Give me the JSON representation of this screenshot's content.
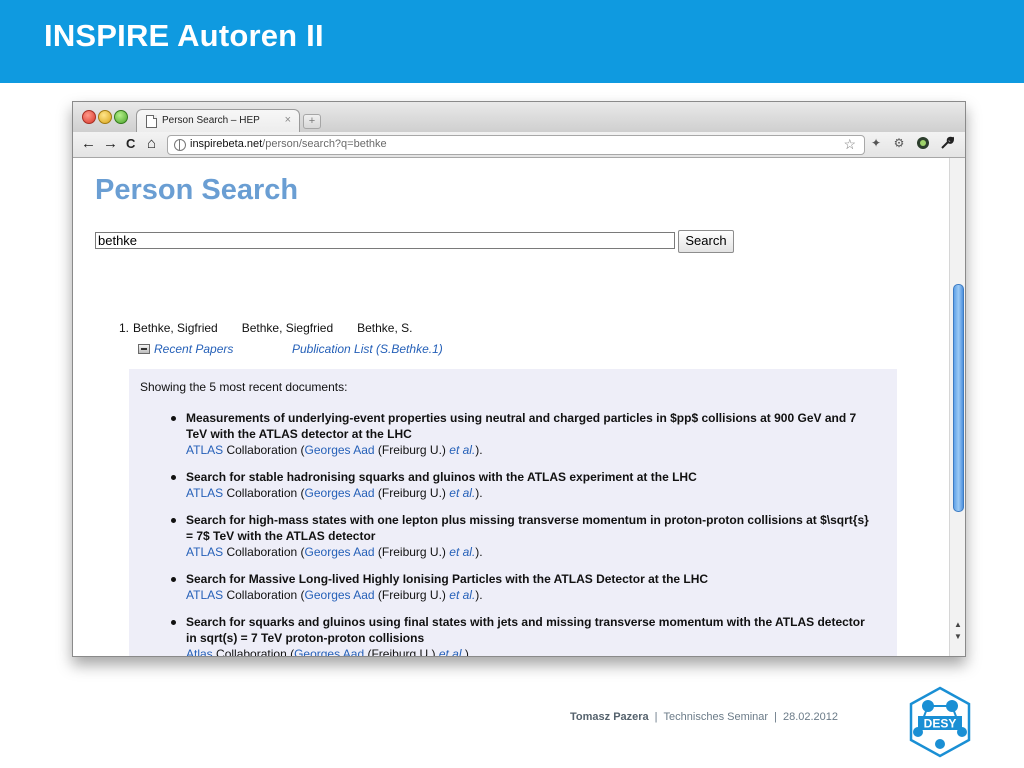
{
  "slide": {
    "title": "INSPIRE Autoren II",
    "footer": {
      "author": "Tomasz Pazera",
      "event": "Technisches Seminar",
      "date": "28.02.2012",
      "separator": "|"
    },
    "logo_text": "DESY"
  },
  "browser": {
    "tab_title": "Person Search – HEP",
    "tab_close": "×",
    "new_tab": "+",
    "url_host": "inspirebeta.net",
    "url_path": "/person/search?q=bethke",
    "nav_back": "←",
    "nav_forward": "→",
    "nav_reload": "C",
    "nav_home": "⌂",
    "bookmark_star": "☆"
  },
  "page": {
    "heading": "Person Search",
    "search_value": "bethke",
    "search_button": "Search",
    "result": {
      "index": "1.",
      "names": [
        "Bethke, Sigfried",
        "Bethke, Siegfried",
        "Bethke, S."
      ],
      "recent_papers_link": "Recent Papers",
      "publication_list_link": "Publication List (S.Bethke.1)",
      "showing_text": "Showing the 5 most recent documents:",
      "documents": [
        {
          "title": "Measurements of underlying-event properties using neutral and charged particles in $pp$ collisions at 900 GeV and 7 TeV with the ATLAS detector at the LHC",
          "collab": "ATLAS",
          "collab_suffix": "Collaboration (",
          "author": "Georges Aad",
          "affil": "(Freiburg U.)",
          "etal": "et al.",
          "tail": ")."
        },
        {
          "title": "Search for stable hadronising squarks and gluinos with the ATLAS experiment at the LHC",
          "collab": "ATLAS",
          "collab_suffix": "Collaboration (",
          "author": "Georges Aad",
          "affil": "(Freiburg U.)",
          "etal": "et al.",
          "tail": ")."
        },
        {
          "title": "Search for high-mass states with one lepton plus missing transverse momentum in proton-proton collisions at $\\sqrt{s} = 7$ TeV with the ATLAS detector",
          "collab": "ATLAS",
          "collab_suffix": "Collaboration (",
          "author": "Georges Aad",
          "affil": "(Freiburg U.)",
          "etal": "et al.",
          "tail": ")."
        },
        {
          "title": "Search for Massive Long-lived Highly Ionising Particles with the ATLAS Detector at the LHC",
          "collab": "ATLAS",
          "collab_suffix": "Collaboration (",
          "author": "Georges Aad",
          "affil": "(Freiburg U.)",
          "etal": "et al.",
          "tail": ")."
        },
        {
          "title": "Search for squarks and gluinos using final states with jets and missing transverse momentum with the ATLAS detector in sqrt(s) = 7 TeV proton-proton collisions",
          "collab": "Atlas",
          "collab_suffix": "Collaboration (",
          "author": "Georges Aad",
          "affil": "(Freiburg U.)",
          "etal": "et al.",
          "tail": ")."
        }
      ]
    }
  },
  "colors": {
    "header_blue": "#0f9ae0",
    "heading_blue": "#6a9ed3",
    "link_blue": "#2560b8",
    "panel_bg": "#eeeef8"
  }
}
